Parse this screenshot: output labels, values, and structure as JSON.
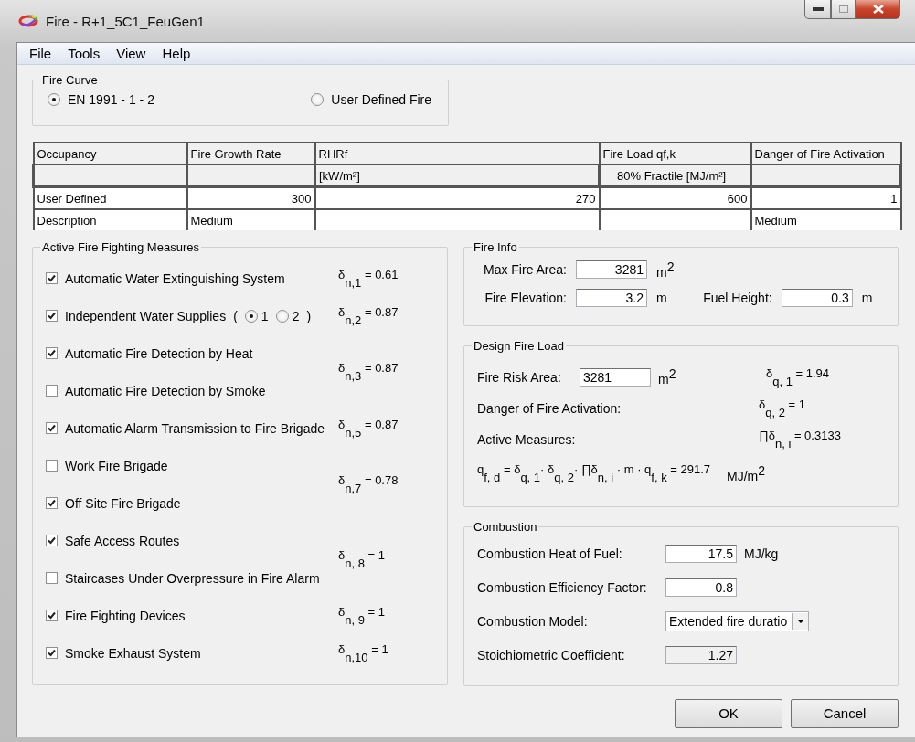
{
  "window": {
    "title": "Fire - R+1_5C1_FeuGen1"
  },
  "menu": [
    "File",
    "Tools",
    "View",
    "Help"
  ],
  "fire_curve": {
    "title": "Fire Curve",
    "options": [
      {
        "label": "EN 1991 - 1 - 2",
        "selected": true
      },
      {
        "label": "User Defined Fire",
        "selected": false
      }
    ]
  },
  "table": {
    "columns": [
      {
        "label": "Occupancy"
      },
      {
        "label": "Fire Growth Rate"
      },
      {
        "label": "RHRf",
        "unit": "[kW/m²]"
      },
      {
        "label": "Fire Load qf,k",
        "unit": "80% Fractile [MJ/m²]"
      },
      {
        "label": "Danger of Fire Activation"
      }
    ],
    "rows": [
      {
        "kind": "values",
        "cells": [
          "User Defined",
          "300",
          "270",
          "600",
          "1"
        ]
      },
      {
        "kind": "text",
        "cells": [
          "Description",
          "Medium",
          null,
          null,
          "Medium"
        ]
      }
    ]
  },
  "measures": {
    "title": "Active Fire Fighting Measures",
    "groups": [
      {
        "factor": "δ$_{n,1}$ = 0.61",
        "items": [
          {
            "label": "Automatic Water Extinguishing System",
            "checked": true
          }
        ]
      },
      {
        "factor": "δ$_{n,2}$ = 0.87",
        "items": [
          {
            "label": "Independent Water Supplies",
            "checked": true,
            "bracket_open": "(",
            "bracket_close": ")",
            "options": [
              {
                "label": "1",
                "selected": true
              },
              {
                "label": "2",
                "selected": false
              }
            ]
          }
        ]
      },
      {
        "factor": "δ$_{n,3}$ = 0.87",
        "items": [
          {
            "label": "Automatic Fire Detection by Heat",
            "checked": true
          },
          {
            "label": "Automatic Fire Detection by Smoke",
            "checked": false
          }
        ]
      },
      {
        "factor": "δ$_{n,5}$ = 0.87",
        "items": [
          {
            "label": "Automatic Alarm Transmission to Fire Brigade",
            "checked": true
          }
        ]
      },
      {
        "factor": "δ$_{n,7}$ = 0.78",
        "items": [
          {
            "label": "Work Fire Brigade",
            "checked": false
          },
          {
            "label": "Off Site Fire Brigade",
            "checked": true
          }
        ]
      },
      {
        "factor": "δ$_{n, 8}$ = 1",
        "items": [
          {
            "label": "Safe Access Routes",
            "checked": true
          },
          {
            "label": "Staircases Under Overpressure in Fire Alarm",
            "checked": false
          }
        ]
      },
      {
        "factor": "δ$_{n, 9}$ = 1",
        "items": [
          {
            "label": "Fire Fighting Devices",
            "checked": true
          }
        ]
      },
      {
        "factor": "δ$_{n,10}$ = 1",
        "items": [
          {
            "label": "Smoke Exhaust System",
            "checked": true
          }
        ]
      }
    ]
  },
  "fire_info": {
    "title": "Fire Info",
    "rows": [
      [
        {
          "label": "Max Fire Area:",
          "value": "3281",
          "unit": "m$^{2}$"
        }
      ],
      [
        {
          "label": "Fire Elevation:",
          "value": "3.2",
          "unit": "m"
        },
        {
          "label": "Fuel Height:",
          "value": "0.3",
          "unit": "m"
        }
      ]
    ]
  },
  "design_fire_load": {
    "title": "Design Fire Load",
    "rows": [
      {
        "label": "Fire Risk Area:",
        "value": "3281",
        "unit": "m$^{2}$",
        "factor": "δ$_{q, 1}$ = 1.94"
      },
      {
        "label": "Danger of Fire Activation:",
        "factor": "δ$_{q, 2}$ = 1"
      },
      {
        "label": "Active Measures:",
        "factor": "∏δ$_{n, i}$ = 0.3133"
      }
    ],
    "formula": "q$_{f, d}$ = δ$_{q, 1}$· δ$_{q, 2}$· ∏δ$_{n, i}$ · m · q$_{f, k}$ = 291.7",
    "formula_unit": "MJ/m$^{2}$"
  },
  "combustion": {
    "title": "Combustion",
    "rows": [
      {
        "kind": "input",
        "label": "Combustion Heat of Fuel:",
        "value": "17.5",
        "unit": "MJ/kg"
      },
      {
        "kind": "input",
        "label": "Combustion Efficiency Factor:",
        "value": "0.8"
      },
      {
        "kind": "select",
        "label": "Combustion Model:",
        "value": "Extended fire duratio"
      },
      {
        "kind": "readonly",
        "label": "Stoichiometric Coefficient:",
        "value": "1.27"
      }
    ]
  },
  "buttons": [
    "OK",
    "Cancel"
  ]
}
